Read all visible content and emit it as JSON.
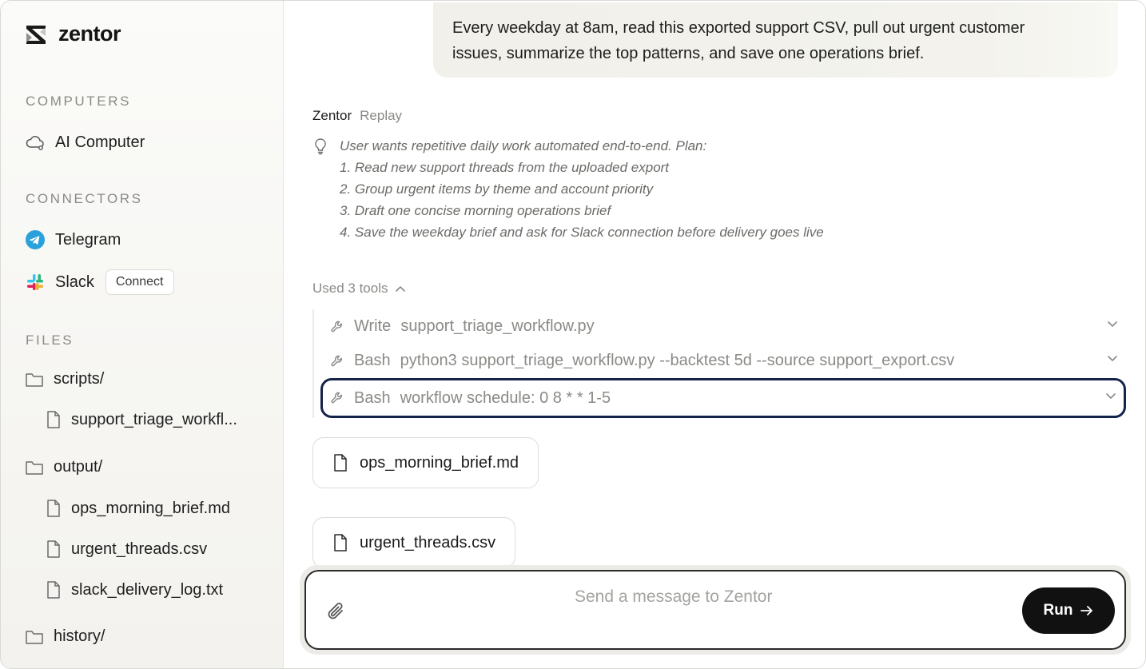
{
  "brand": {
    "name": "zentor",
    "logo_icon": "zentor-logo-icon"
  },
  "sidebar": {
    "computers_title": "COMPUTERS",
    "computers": [
      {
        "label": "AI Computer",
        "icon": "cloud-icon"
      }
    ],
    "connectors_title": "CONNECTORS",
    "connectors": [
      {
        "label": "Telegram",
        "icon": "telegram-icon"
      },
      {
        "label": "Slack",
        "icon": "slack-icon",
        "action": "Connect"
      }
    ],
    "files_title": "FILES",
    "files": [
      {
        "label": "scripts/",
        "type": "folder"
      },
      {
        "label": "support_triage_workfl...",
        "type": "file"
      },
      {
        "label": "output/",
        "type": "folder"
      },
      {
        "label": "ops_morning_brief.md",
        "type": "file"
      },
      {
        "label": "urgent_threads.csv",
        "type": "file"
      },
      {
        "label": "slack_delivery_log.txt",
        "type": "file"
      },
      {
        "label": "history/",
        "type": "folder"
      }
    ]
  },
  "chat": {
    "user_message": {
      "line1": "Every weekday at 8am, read this exported support CSV, pull out urgent customer",
      "line2": "issues, summarize the top patterns, and save one operations brief."
    },
    "assistant_name": "Zentor",
    "replay_label": "Replay",
    "thought_lines": [
      "User wants repetitive daily work automated end-to-end. Plan:",
      "1. Read new support threads from the uploaded export",
      "2. Group urgent items by theme and account priority",
      "3. Draft one concise morning operations brief",
      "4. Save the weekday brief and ask for Slack connection before delivery goes live"
    ],
    "tools_label": "Used 3 tools",
    "tools": [
      {
        "name": "Write",
        "detail": "support_triage_workflow.py"
      },
      {
        "name": "Bash",
        "detail": "python3 support_triage_workflow.py --backtest 5d --source support_export.csv"
      },
      {
        "name": "Bash",
        "detail": "workflow schedule: 0 8 * * 1-5"
      }
    ],
    "file_cards": [
      "ops_morning_brief.md",
      "urgent_threads.csv"
    ]
  },
  "composer": {
    "placeholder": "Send a message to Zentor",
    "run_label": "Run"
  },
  "colors": {
    "accent_border": "#14234a",
    "run_button": "#111111",
    "telegram": "#2aa1da"
  }
}
